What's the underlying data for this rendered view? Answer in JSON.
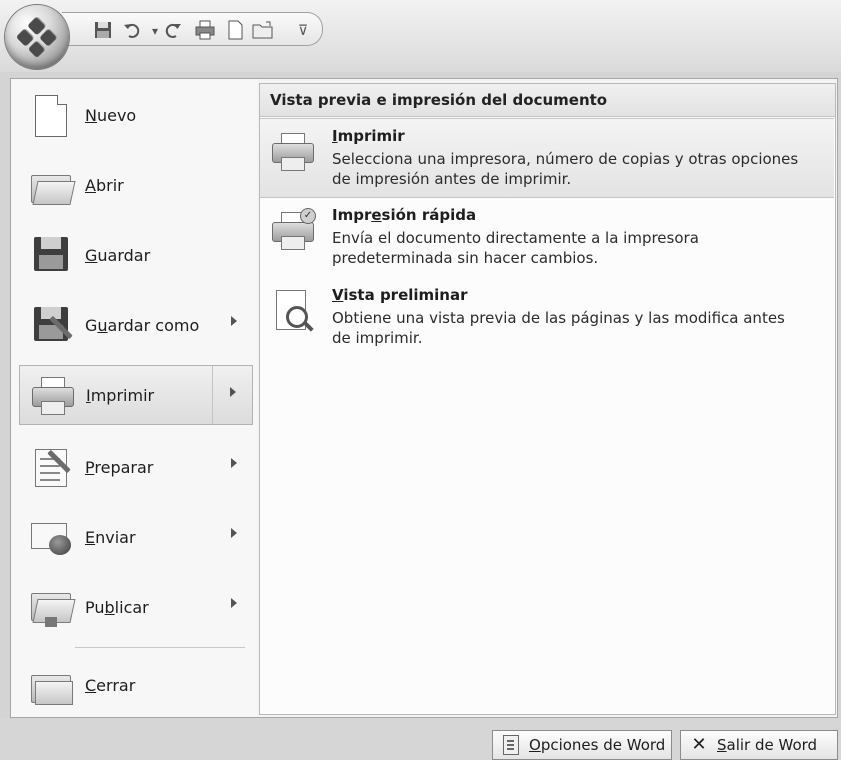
{
  "quick_access": {
    "icons": [
      "office-button-icon",
      "save-icon",
      "undo-icon",
      "undo-dropdown-icon",
      "redo-icon",
      "print-icon",
      "new-document-icon",
      "open-icon",
      "customize-toolbar-icon"
    ]
  },
  "left_menu": {
    "items": [
      {
        "pre": "",
        "key": "N",
        "post": "uevo"
      },
      {
        "pre": "",
        "key": "A",
        "post": "brir"
      },
      {
        "pre": "",
        "key": "G",
        "post": "uardar"
      },
      {
        "pre": "G",
        "key": "u",
        "post": "ardar como"
      },
      {
        "pre": "",
        "key": "I",
        "post": "mprimir"
      },
      {
        "pre": "",
        "key": "P",
        "post": "reparar"
      },
      {
        "pre": "",
        "key": "E",
        "post": "nviar"
      },
      {
        "pre": "Pu",
        "key": "b",
        "post": "licar"
      },
      {
        "pre": "",
        "key": "C",
        "post": "errar"
      }
    ]
  },
  "right_pane": {
    "header": "Vista previa e impresión del documento",
    "options": [
      {
        "title_pre": "",
        "title_key": "I",
        "title_post": "mprimir",
        "description": "Selecciona una impresora, número de copias y otras opciones de impresión antes de imprimir."
      },
      {
        "title_pre": "Impr",
        "title_key": "e",
        "title_post": "sión rápida",
        "description": "Envía el documento directamente a la impresora predeterminada sin hacer cambios."
      },
      {
        "title_pre": "",
        "title_key": "V",
        "title_post": "ista preliminar",
        "description": "Obtiene una vista previa de las páginas y las modifica antes de imprimir."
      }
    ]
  },
  "bottom": {
    "word_options": {
      "key": "O",
      "post": "pciones de Word"
    },
    "exit_word": {
      "key": "S",
      "post": "alir de Word"
    }
  },
  "colors": {
    "background": "#d4d4d4",
    "menu_bg": "#f7f7f7",
    "highlight": "#e3e3e3"
  }
}
